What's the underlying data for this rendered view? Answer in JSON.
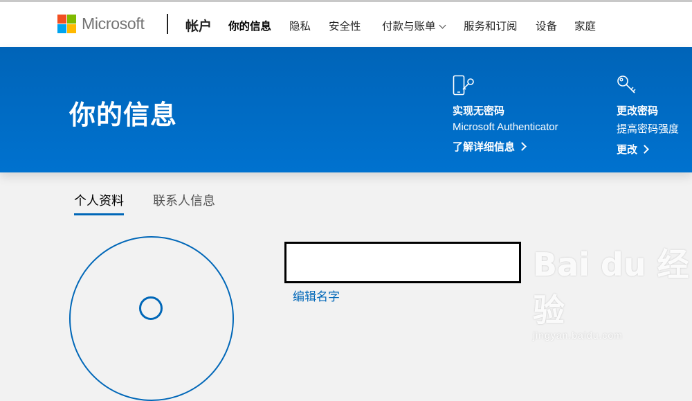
{
  "header": {
    "logo_text": "Microsoft",
    "account_label": "帐户",
    "nav": [
      {
        "label": "你的信息",
        "active": true
      },
      {
        "label": "隐私"
      },
      {
        "label": "安全性"
      },
      {
        "label": "付款与账单",
        "dropdown": true
      },
      {
        "label": "服务和订阅"
      },
      {
        "label": "设备"
      },
      {
        "label": "家庭"
      }
    ]
  },
  "banner": {
    "title": "你的信息",
    "promos": [
      {
        "icon": "phone-key-icon",
        "title": "实现无密码",
        "subtitle": "Microsoft Authenticator",
        "link": "了解详细信息"
      },
      {
        "icon": "key-icon",
        "title": "更改密码",
        "subtitle": "提高密码强度",
        "link": "更改"
      }
    ]
  },
  "tabs": [
    {
      "label": "个人资料",
      "active": true
    },
    {
      "label": "联系人信息"
    }
  ],
  "profile": {
    "edit_name_link": "编辑名字"
  },
  "watermark": {
    "brand": "Bai du 经验",
    "url": "jingyan.baidu.com"
  },
  "colors": {
    "brand_blue": "#0067b8",
    "banner_blue": "#0072cf",
    "ms_red": "#f25022",
    "ms_green": "#7fba00",
    "ms_blue": "#00a4ef",
    "ms_yellow": "#ffb900"
  }
}
